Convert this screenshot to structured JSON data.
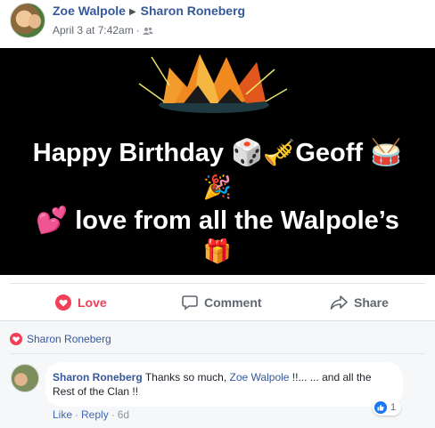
{
  "post": {
    "author": "Zoe Walpole",
    "recipient": "Sharon Roneberg",
    "timestamp": "April 3 at 7:42am",
    "privacy_icon": "friends-icon"
  },
  "image": {
    "line1_text": "Happy Birthday",
    "line1_name": "Geoff",
    "line2_text": "love from all the Walpole’s",
    "emoji": {
      "dice": "🎲",
      "trumpet": "🎺",
      "drum": "🥁",
      "party": "🎉",
      "hearts": "💕",
      "gift": "🎁"
    }
  },
  "actions": {
    "love_label": "Love",
    "comment_label": "Comment",
    "share_label": "Share"
  },
  "colors": {
    "love": "#f33e58",
    "link": "#365899",
    "like": "#1877f2"
  },
  "reactions": {
    "reacted_by": "Sharon Roneberg"
  },
  "comment": {
    "author": "Sharon Roneberg",
    "text_before": "Thanks so much,",
    "mention": "Zoe Walpole",
    "text_after": "!!... ... and all the Rest of the Clan !!",
    "like_count": "1",
    "like_label": "Like",
    "reply_label": "Reply",
    "age": "6d"
  }
}
